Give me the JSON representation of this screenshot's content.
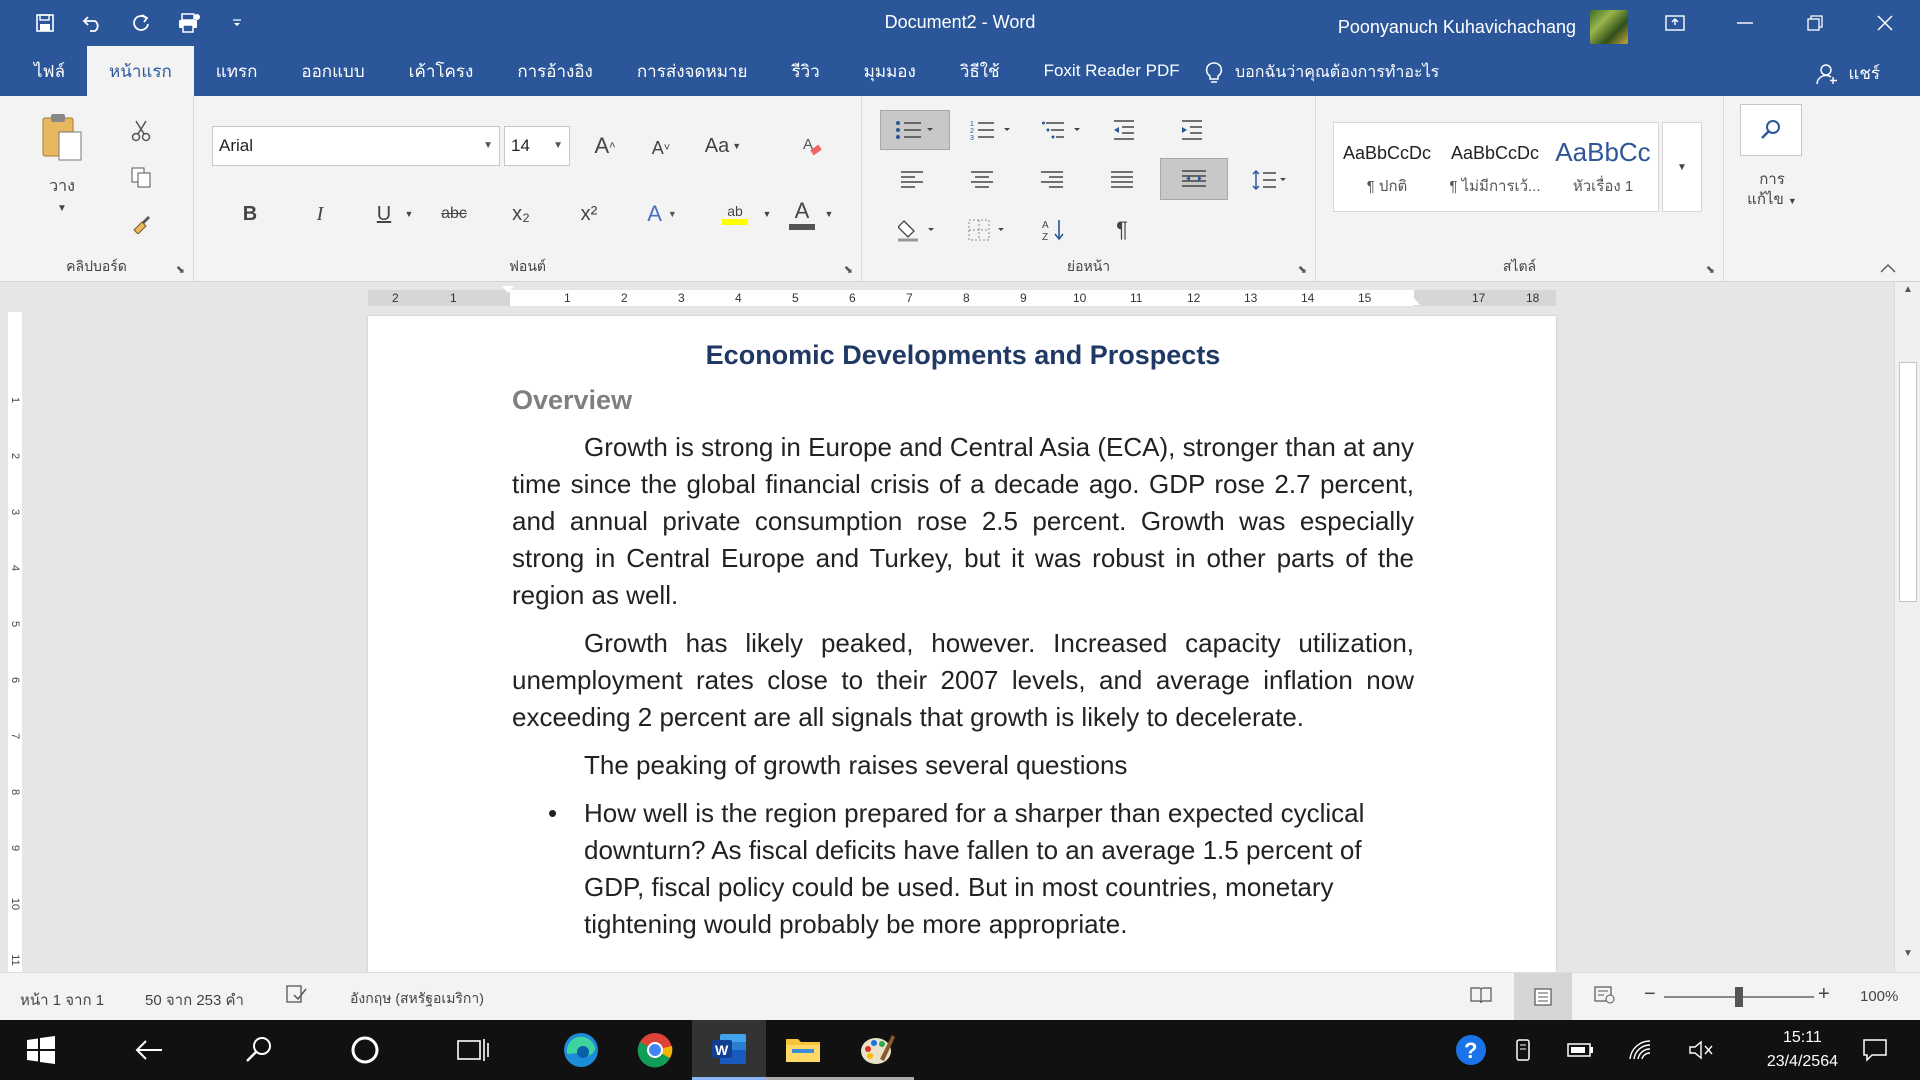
{
  "window": {
    "doc_title": "Document2  -  Word",
    "user_name": "Poonyanuch Kuhavichachang"
  },
  "tabs": [
    "ไฟล์",
    "หน้าแรก",
    "แทรก",
    "ออกแบบ",
    "เค้าโครง",
    "การอ้างอิง",
    "การส่งจดหมาย",
    "รีวิว",
    "มุมมอง",
    "วิธีใช้",
    "Foxit Reader PDF"
  ],
  "active_tab": "หน้าแรก",
  "tell_me": "บอกฉันว่าคุณต้องการทำอะไร",
  "share": "แชร์",
  "ribbon": {
    "clipboard": {
      "paste_label": "วาง",
      "group_label": "คลิปบอร์ด"
    },
    "font": {
      "font_name": "Arial",
      "font_size": "14",
      "change_case": "Aa",
      "bold": "B",
      "italic": "I",
      "underline": "U",
      "strike": "abc",
      "subscript": "x₂",
      "superscript": "x²",
      "text_effects": "A",
      "highlight": "ab",
      "font_color": "A",
      "group_label": "ฟอนต์"
    },
    "paragraph": {
      "group_label": "ย่อหน้า",
      "show_marks": "¶"
    },
    "styles": {
      "items": [
        {
          "preview": "AaBbCcDc",
          "name": "¶ ปกติ"
        },
        {
          "preview": "AaBbCcDc",
          "name": "¶ ไม่มีการเว้..."
        },
        {
          "preview": "AaBbCc",
          "name": "หัวเรื่อง 1"
        }
      ],
      "group_label": "สไตล์"
    },
    "editing": {
      "label_line1": "การ",
      "label_line2": "แก้ไข"
    }
  },
  "document": {
    "heading": "Economic Developments and Prospects",
    "subheading": "Overview",
    "paragraphs": [
      "Growth is strong in Europe and Central Asia (ECA), stronger than at any time since the global financial crisis of a decade ago. GDP rose 2.7 percent, and annual private consumption rose 2.5 percent. Growth was especially strong in Central Europe and Turkey, but it was robust in other parts of the region as well.",
      "Growth has likely peaked, however. Increased capacity utilization, unemployment rates close to their 2007 levels, and average inflation now exceeding 2 percent are all signals that growth is likely to decelerate.",
      "The peaking of growth raises several questions"
    ],
    "bullets": [
      "How well is the region prepared for a sharper than expected cyclical downturn? As fiscal deficits have fallen to an average 1.5 percent of GDP, fiscal policy could be used. But in most countries, monetary tightening would probably be more appropriate."
    ]
  },
  "ruler": {
    "h_numbers": [
      "2",
      "1",
      "1",
      "2",
      "3",
      "4",
      "5",
      "6",
      "7",
      "8",
      "9",
      "10",
      "11",
      "12",
      "13",
      "14",
      "15",
      "17",
      "18"
    ],
    "v_numbers": [
      "1",
      "2",
      "3",
      "4",
      "5",
      "6",
      "7",
      "8",
      "9",
      "10",
      "11"
    ]
  },
  "status": {
    "page": "หน้า 1 จาก 1",
    "words": "50 จาก 253 คำ",
    "language": "อังกฤษ (สหรัฐอเมริกา)",
    "zoom": "100%",
    "zoom_fraction": 0.5
  },
  "taskbar": {
    "time": "15:11",
    "date": "23/4/2564"
  },
  "colors": {
    "accent": "#2b579a",
    "heading": "#1f3864",
    "subheading": "#7f7f7f"
  }
}
